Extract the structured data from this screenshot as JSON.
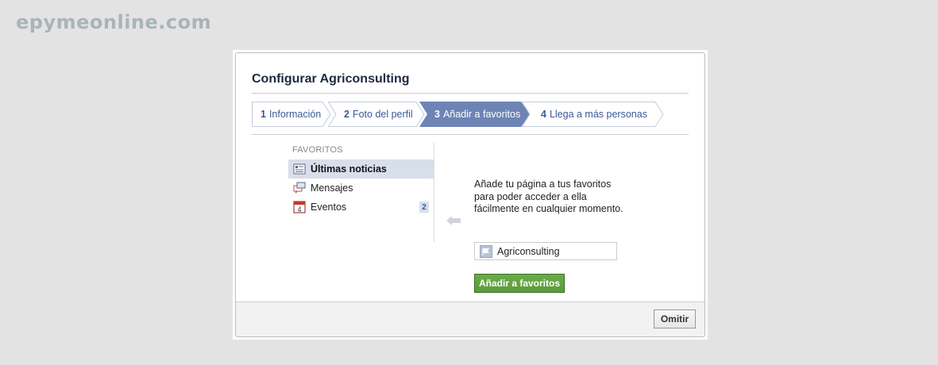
{
  "watermark": "epymeonline.com",
  "dialog": {
    "title": "Configurar Agriconsulting",
    "steps": [
      {
        "num": "1",
        "label": "Información",
        "active": false
      },
      {
        "num": "2",
        "label": "Foto del perfil",
        "active": false
      },
      {
        "num": "3",
        "label": "Añadir a favoritos",
        "active": true
      },
      {
        "num": "4",
        "label": "Llega a más personas",
        "active": false
      }
    ],
    "favorites": {
      "header": "FAVORITOS",
      "items": [
        {
          "label": "Últimas noticias",
          "icon": "news-feed-icon",
          "selected": true
        },
        {
          "label": "Mensajes",
          "icon": "messages-icon",
          "selected": false
        },
        {
          "label": "Eventos",
          "icon": "calendar-icon",
          "selected": false,
          "badge": "2",
          "calendar_day": "4"
        }
      ]
    },
    "description": "Añade tu página a tus favoritos para poder acceder a ella fácilmente en cualquier momento.",
    "page_name": "Agriconsulting",
    "add_button": "Añadir a favoritos",
    "skip_button": "Omitir"
  },
  "colors": {
    "accent": "#3b5998",
    "active_step": "#6d84b4",
    "green_button": "#5f9e40",
    "selected_row": "#d8dfea"
  }
}
